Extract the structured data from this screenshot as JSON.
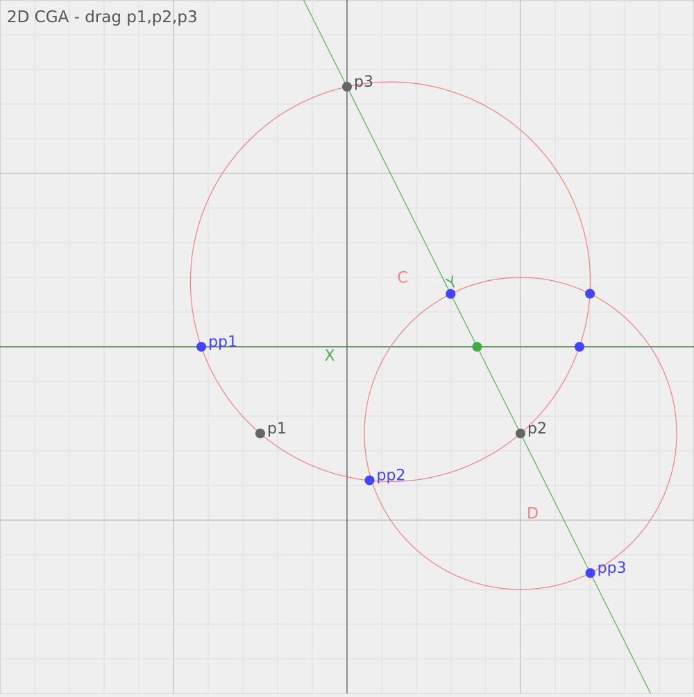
{
  "title": "2D CGA - drag p1,p2,p3",
  "colors": {
    "background": "#efefef",
    "grid_minor": "#e0e0e0",
    "grid_major": "#bdbdbd",
    "axis": "#666666",
    "circle": "#f08080",
    "line": "#66bb66",
    "line_h": "#559955",
    "label_green": "#4caf50",
    "point_gray": "#666666",
    "point_blue": "#4444ff",
    "point_green": "#44aa44",
    "text_gray": "#555555"
  },
  "points": {
    "p1": {
      "label": "p1",
      "x": -0.5,
      "y": -0.5
    },
    "p2": {
      "label": "p2",
      "x": 1.0,
      "y": -0.5
    },
    "p3": {
      "label": "p3",
      "x": 0.0,
      "y": 1.5
    }
  },
  "line_labels": {
    "X": "X",
    "Y": "Y"
  },
  "circle_labels": {
    "C": "C",
    "D": "D"
  },
  "projections": {
    "pp1": {
      "label": "pp1"
    },
    "pp2": {
      "label": "pp2"
    },
    "pp3": {
      "label": "pp3"
    }
  }
}
